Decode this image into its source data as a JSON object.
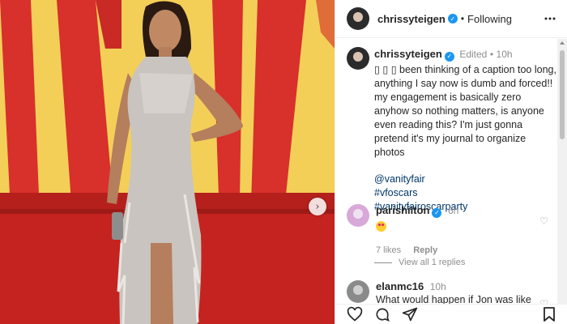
{
  "photo": {
    "alt_shape_colors": {
      "backdrop_yellow": "#f4cf58",
      "backdrop_red": "#d8302b",
      "carpet": "#c4231f",
      "dress": "#c9c4bf",
      "skin": "#b57e5d"
    },
    "next_icon": "chevron-right-icon"
  },
  "header": {
    "username": "chrissyteigen",
    "separator": "•",
    "follow_status": "Following",
    "more_icon": "more-icon"
  },
  "caption": {
    "username": "chrissyteigen",
    "edited": "Edited",
    "separator": "•",
    "time": "10h",
    "text": "▯ ▯ ▯ been thinking of a caption too long, anything I say now is dumb and forced!! my engagement is basically zero anyhow so nothing matters, is anyone even reading this? I'm just gonna pretend it's my journal to organize photos",
    "tags": [
      "@vanityfair",
      "#vfoscars",
      "#vanityfairoscarparty"
    ]
  },
  "comments": [
    {
      "username": "parishilton",
      "time": "6h",
      "likes": "7 likes",
      "reply_label": "Reply",
      "view_replies": "View all 1 replies"
    },
    {
      "username": "elanmc16",
      "time": "10h",
      "text": "What would happen if Jon was like"
    }
  ],
  "accent": {
    "verified": "#1c96f0",
    "link": "#00376b"
  }
}
